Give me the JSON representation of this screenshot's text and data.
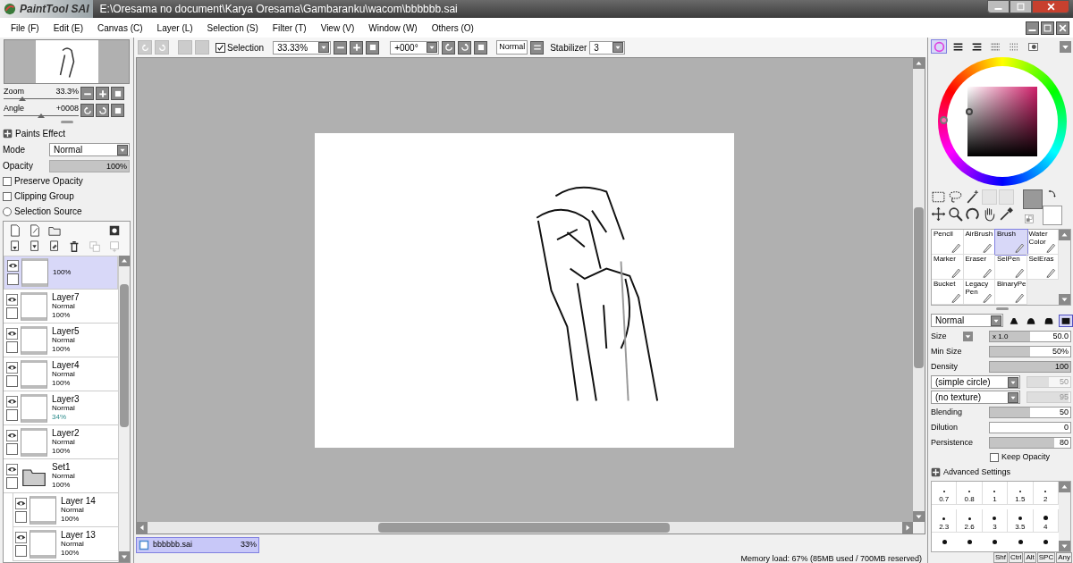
{
  "window": {
    "app_name": "PaintTool SAI",
    "title": "E:\\Oresama no document\\Karya Oresama\\Gambaranku\\wacom\\bbbbbb.sai"
  },
  "menu": [
    "File (F)",
    "Edit (E)",
    "Canvas (C)",
    "Layer (L)",
    "Selection (S)",
    "Filter (T)",
    "View (V)",
    "Window (W)",
    "Others (O)"
  ],
  "toolbar": {
    "selection": {
      "label": "Selection",
      "checked": true
    },
    "zoom": "33.33%",
    "angle": "+000°",
    "mode": "Normal",
    "stabilizer_label": "Stabilizer",
    "stabilizer": "3"
  },
  "navigator": {
    "zoom": {
      "label": "Zoom",
      "value": "33.3%",
      "level": 0.25
    },
    "angle": {
      "label": "Angle",
      "value": "+0008",
      "level": 0.5
    }
  },
  "layer_props": {
    "paints_effect": "Paints Effect",
    "mode_label": "Mode",
    "mode": "Normal",
    "opacity": {
      "label": "Opacity",
      "value": "100%",
      "level": 1
    },
    "options": [
      {
        "kind": "checkbox",
        "label": "Preserve Opacity",
        "checked": false
      },
      {
        "kind": "checkbox",
        "label": "Clipping Group",
        "checked": false
      },
      {
        "kind": "radio",
        "label": "Selection Source",
        "checked": false
      }
    ]
  },
  "layers": [
    {
      "kind": "layer",
      "opacity": "100%",
      "selected": true
    },
    {
      "kind": "layer",
      "name": "Layer7",
      "mode": "Normal",
      "opacity": "100%",
      "selected": false
    },
    {
      "kind": "layer",
      "name": "Layer5",
      "mode": "Normal",
      "opacity": "100%",
      "selected": false
    },
    {
      "kind": "layer",
      "name": "Layer4",
      "mode": "Normal",
      "opacity": "100%",
      "selected": false
    },
    {
      "kind": "layer",
      "name": "Layer3",
      "mode": "Normal",
      "opacity": "34%",
      "selected": false
    },
    {
      "kind": "layer",
      "name": "Layer2",
      "mode": "Normal",
      "opacity": "100%",
      "selected": false
    },
    {
      "kind": "folder",
      "name": "Set1",
      "mode": "Normal",
      "opacity": "100%",
      "selected": false,
      "children": [
        {
          "kind": "layer",
          "name": "Layer 14",
          "mode": "Normal",
          "opacity": "100%",
          "selected": false
        },
        {
          "kind": "layer",
          "name": "Layer 13",
          "mode": "Normal",
          "opacity": "100%",
          "selected": false
        }
      ]
    }
  ],
  "document_tabs": [
    {
      "name": "bbbbbb.sai",
      "zoom": "33%",
      "selected": true
    }
  ],
  "status_bar": {
    "memory": "Memory load: 67% (85MB used / 700MB reserved)",
    "keys": [
      "Shf",
      "Ctrl",
      "Alt",
      "SPC",
      "Any"
    ]
  },
  "panel_tabs": [
    {
      "selected": true
    },
    {
      "selected": false
    },
    {
      "selected": false
    },
    {
      "selected": false
    },
    {
      "selected": false
    },
    {
      "selected": false
    }
  ],
  "tools": [
    {
      "label": "Pencil",
      "selected": false
    },
    {
      "label": "AirBrush",
      "selected": false
    },
    {
      "label": "Brush",
      "selected": true
    },
    {
      "label": "Water Color",
      "selected": false
    },
    {
      "label": "Marker",
      "selected": false
    },
    {
      "label": "Eraser",
      "selected": false
    },
    {
      "label": "SelPen",
      "selected": false
    },
    {
      "label": "SelEras",
      "selected": false
    },
    {
      "label": "Bucket",
      "selected": false
    },
    {
      "label": "Legacy Pen",
      "selected": false
    },
    {
      "label": "BinaryPe",
      "selected": false
    }
  ],
  "brush": {
    "blend_mode": "Normal",
    "shapes": [
      {
        "selected": false
      },
      {
        "selected": false
      },
      {
        "selected": false
      },
      {
        "selected": true
      }
    ],
    "settings": [
      {
        "kind": "slider",
        "label": "Size",
        "multiplier": "x 1.0",
        "value": "50.0",
        "level": 0.5
      },
      {
        "kind": "slider",
        "label": "Min Size",
        "value": "50%",
        "level": 0.5
      },
      {
        "kind": "slider",
        "label": "Density",
        "value": "100",
        "level": 1
      },
      {
        "kind": "select",
        "label": "(simple circle)",
        "value": "50",
        "level": 0.5,
        "disabled": true
      },
      {
        "kind": "select",
        "label": "(no texture)",
        "value": "95",
        "level": 0.95,
        "disabled": true
      },
      {
        "kind": "slider",
        "label": "Blending",
        "value": "50",
        "level": 0.5
      },
      {
        "kind": "slider",
        "label": "Dilution",
        "value": "0",
        "level": 0
      },
      {
        "kind": "slider",
        "label": "Persistence",
        "value": "80",
        "level": 0.8
      }
    ],
    "keep_opacity": {
      "label": "Keep Opacity",
      "checked": false
    },
    "advanced": "Advanced Settings",
    "sizes": [
      "0.7",
      "0.8",
      "1",
      "1.5",
      "2",
      "2.3",
      "2.6",
      "3",
      "3.5",
      "4"
    ]
  }
}
